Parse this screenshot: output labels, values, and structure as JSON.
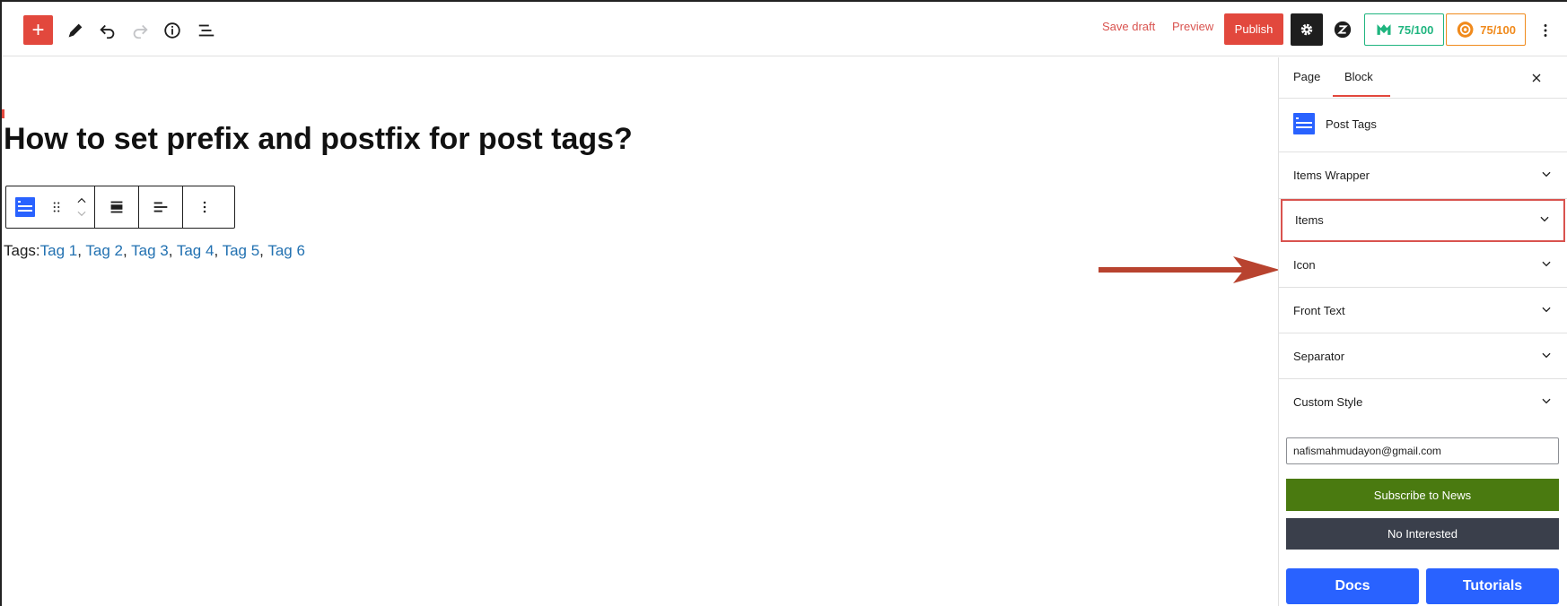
{
  "toolbar": {
    "add_label": "+",
    "save_draft_label": "Save draft",
    "preview_label": "Preview",
    "publish_label": "Publish",
    "score_green": "75/100",
    "score_orange": "75/100"
  },
  "editor": {
    "title": "How to set prefix and postfix for post tags?",
    "tags_prefix": "Tags:",
    "tags": [
      "Tag 1",
      "Tag 2",
      "Tag 3",
      "Tag 4",
      "Tag 5",
      "Tag 6"
    ],
    "tag_separator": ", "
  },
  "sidebar": {
    "tabs": [
      {
        "label": "Page"
      },
      {
        "label": "Block"
      }
    ],
    "block_name": "Post Tags",
    "panels": [
      {
        "label": "Items Wrapper"
      },
      {
        "label": "Items"
      },
      {
        "label": "Icon"
      },
      {
        "label": "Front Text"
      },
      {
        "label": "Separator"
      },
      {
        "label": "Custom Style"
      }
    ],
    "email_value": "nafismahmudayon@gmail.com",
    "subscribe_label": "Subscribe to News",
    "no_interest_label": "No Interested",
    "docs_label": "Docs",
    "tutorials_label": "Tutorials"
  },
  "colors": {
    "accent_red": "#e2483d",
    "link_blue": "#2271b1",
    "score_green": "#1fb57f",
    "score_orange": "#f08a1c",
    "subscribe_green": "#4a7a10",
    "dark_button": "#3a3f4b",
    "docs_blue": "#2962ff",
    "arrow_red": "#b8432f"
  }
}
